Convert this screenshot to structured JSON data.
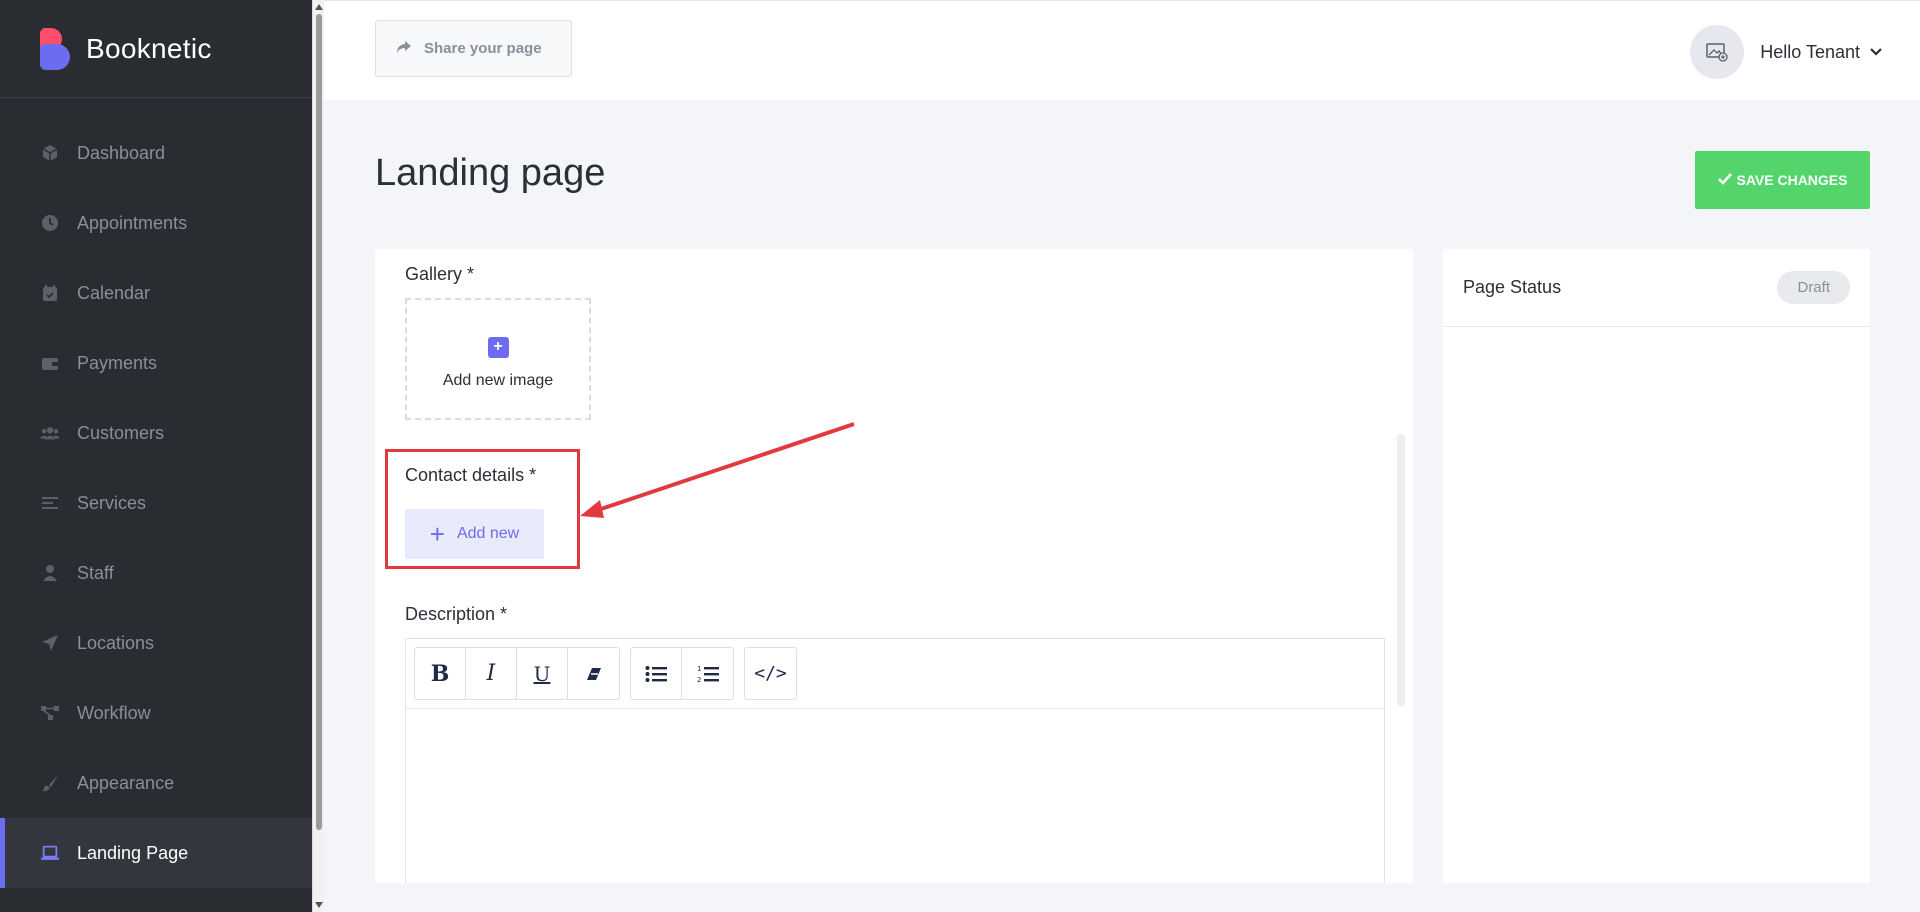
{
  "app": {
    "name": "Booknetic"
  },
  "sidebar": {
    "items": [
      {
        "label": "Dashboard",
        "icon": "box-icon"
      },
      {
        "label": "Appointments",
        "icon": "clock-icon"
      },
      {
        "label": "Calendar",
        "icon": "calendar-icon"
      },
      {
        "label": "Payments",
        "icon": "wallet-icon"
      },
      {
        "label": "Customers",
        "icon": "users-icon"
      },
      {
        "label": "Services",
        "icon": "list-icon"
      },
      {
        "label": "Staff",
        "icon": "user-icon"
      },
      {
        "label": "Locations",
        "icon": "location-arrow-icon"
      },
      {
        "label": "Workflow",
        "icon": "workflow-icon"
      },
      {
        "label": "Appearance",
        "icon": "brush-icon"
      },
      {
        "label": "Landing Page",
        "icon": "laptop-icon",
        "active": true
      }
    ]
  },
  "header": {
    "share_label": "Share your page",
    "user_greeting": "Hello Tenant"
  },
  "page": {
    "title": "Landing page",
    "save_label": "SAVE CHANGES"
  },
  "form": {
    "gallery_label": "Gallery *",
    "add_image_label": "Add new image",
    "contact_label": "Contact details *",
    "add_new_label": "Add new",
    "description_label": "Description *",
    "code_label": "</>"
  },
  "side": {
    "title": "Page Status",
    "status": "Draft"
  },
  "colors": {
    "accent": "#6c6cf0",
    "save": "#53d56c",
    "annotation": "#e0393e",
    "sidebar_bg": "#292d32"
  }
}
